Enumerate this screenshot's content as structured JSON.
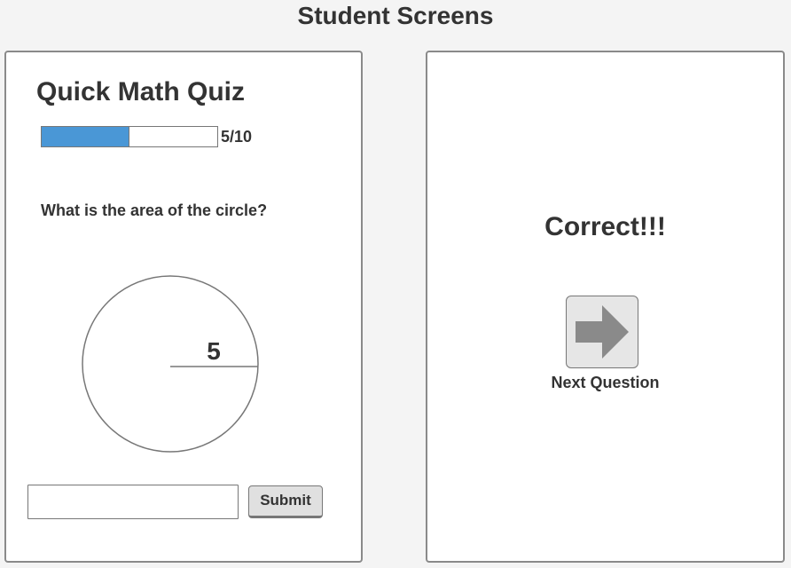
{
  "page": {
    "heading": "Student Screens"
  },
  "quiz_screen": {
    "title": "Quick Math Quiz",
    "progress": {
      "current": 5,
      "total": 10,
      "fraction": 0.5,
      "label": "5/10",
      "fill_color": "#4a97d6"
    },
    "question": "What is the area of the circle?",
    "figure": {
      "shape": "circle",
      "radius_label": "5"
    },
    "answer_input": {
      "value": "",
      "placeholder": ""
    },
    "submit_label": "Submit"
  },
  "result_screen": {
    "message": "Correct!!!",
    "next_icon": "arrow-right-icon",
    "next_label": "Next Question"
  }
}
